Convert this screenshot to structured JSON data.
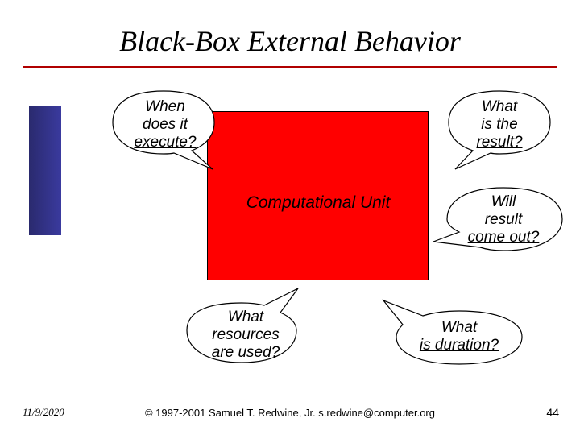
{
  "title": "Black-Box External Behavior",
  "comp_unit": "Computational Unit",
  "callouts": {
    "when": {
      "l1": "When",
      "l2": "does it",
      "l3": "execute?"
    },
    "what_result": {
      "l1": "What",
      "l2": "is the",
      "l3": "result?"
    },
    "will_come": {
      "l1": "Will",
      "l2": "result",
      "l3": "come out?"
    },
    "resources": {
      "l1": "What",
      "l2": "resources",
      "l3": "are used?"
    },
    "duration": {
      "l1": "What",
      "l2": "is duration?"
    }
  },
  "footer": {
    "date": "11/9/2020",
    "copyright": "© 1997-2001 Samuel T. Redwine, Jr.  s.redwine@computer.org",
    "page": "44"
  }
}
